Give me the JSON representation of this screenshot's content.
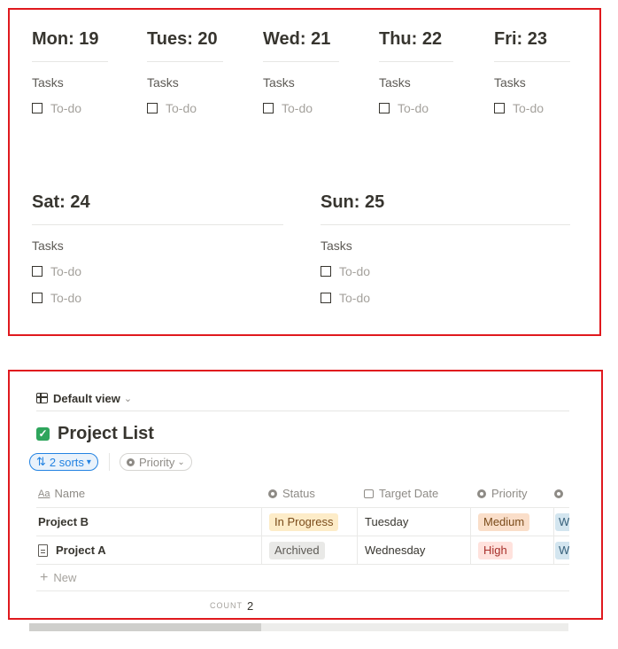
{
  "week": {
    "days": [
      {
        "title": "Mon: 19",
        "tasks_label": "Tasks",
        "todos": [
          "To-do"
        ]
      },
      {
        "title": "Tues: 20",
        "tasks_label": "Tasks",
        "todos": [
          "To-do"
        ]
      },
      {
        "title": "Wed: 21",
        "tasks_label": "Tasks",
        "todos": [
          "To-do"
        ]
      },
      {
        "title": "Thu: 22",
        "tasks_label": "Tasks",
        "todos": [
          "To-do"
        ]
      },
      {
        "title": "Fri: 23",
        "tasks_label": "Tasks",
        "todos": [
          "To-do"
        ]
      },
      {
        "title": "Sat: 24",
        "tasks_label": "Tasks",
        "todos": [
          "To-do",
          "To-do"
        ]
      },
      {
        "title": "Sun: 25",
        "tasks_label": "Tasks",
        "todos": [
          "To-do",
          "To-do"
        ]
      }
    ]
  },
  "project": {
    "view_label": "Default view",
    "title": "Project List",
    "sorts_label": "2 sorts",
    "priority_filter_label": "Priority",
    "columns": {
      "name": "Name",
      "status": "Status",
      "target_date": "Target Date",
      "priority": "Priority"
    },
    "rows": [
      {
        "name": "Project B",
        "status": "In Progress",
        "target_date": "Tuesday",
        "priority": "Medium",
        "extra": "W"
      },
      {
        "name": "Project A",
        "status": "Archived",
        "target_date": "Wednesday",
        "priority": "High",
        "extra": "W"
      }
    ],
    "new_label": "New",
    "count_label": "COUNT",
    "count_value": "2",
    "colors": {
      "accent": "#2383e2",
      "checkbox_green": "#2ea55c",
      "highlight_border": "#e0191e"
    }
  }
}
